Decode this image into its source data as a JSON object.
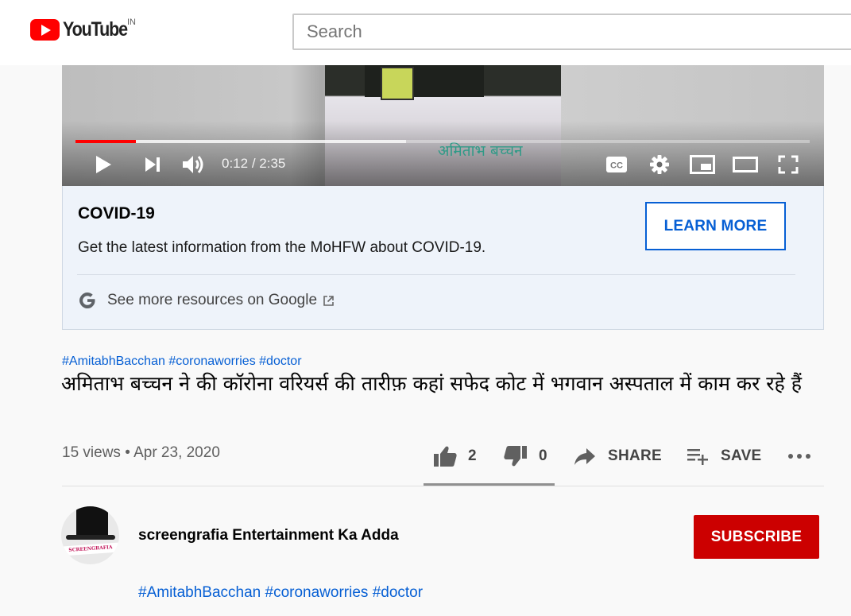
{
  "header": {
    "logo_text": "YouTube",
    "region": "IN",
    "search_placeholder": "Search"
  },
  "player": {
    "overlay_caption": "अमिताभ बच्चन",
    "current_time": "0:12",
    "separator": " / ",
    "duration": "2:35",
    "progress_played_fraction": 0.082,
    "progress_buffered_fraction": 0.45,
    "colors": {
      "played": "#ff0000"
    }
  },
  "covid_panel": {
    "title": "COVID-19",
    "description": "Get the latest information from the MoHFW about COVID-19.",
    "learn_more_label": "LEARN MORE",
    "resources_label": "See more resources on Google"
  },
  "video": {
    "hashtags": [
      "#AmitabhBacchan",
      "#coronaworries",
      "#doctor"
    ],
    "title": "अमिताभ बच्चन ने की कॉरोना वरियर्स की तारीफ़ कहां सफेद कोट में भगवान अस्पताल में काम कर रहे हैं",
    "views_date": "15 views • Apr 23, 2020",
    "likes": "2",
    "dislikes": "0",
    "share_label": "SHARE",
    "save_label": "SAVE"
  },
  "channel": {
    "name": "screengrafia Entertainment Ka Adda",
    "avatar_text": "SCREENGRAFIA",
    "subscribe_label": "SUBSCRIBE",
    "description_hashtags": [
      "#AmitabhBacchan",
      "#coronaworries",
      "#doctor"
    ]
  },
  "colors": {
    "brand_red": "#ff0000",
    "subscribe_red": "#cc0000",
    "link_blue": "#065fd4",
    "panel_bg": "#eef3fa"
  }
}
